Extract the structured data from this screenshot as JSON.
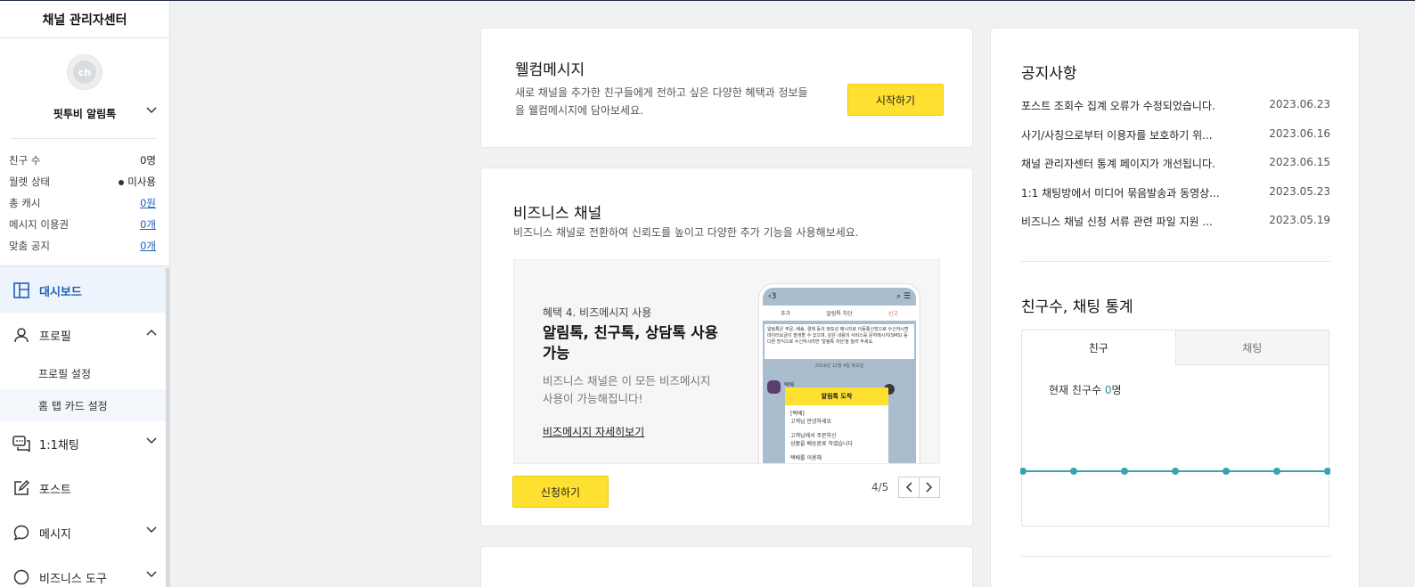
{
  "sidebar": {
    "title": "채널 관리자센터",
    "avatar_text": "ch",
    "channel_name": "핏투비 알림톡",
    "stats": [
      {
        "label": "친구 수",
        "value": "0명",
        "link": false
      },
      {
        "label": "월렛 상태",
        "value": "미사용",
        "link": false,
        "dot": true
      },
      {
        "label": "총 캐시",
        "value": "0원",
        "link": true
      },
      {
        "label": "메시지 이용권",
        "value": "0개",
        "link": true
      },
      {
        "label": "맞춤 공지",
        "value": "0개",
        "link": true
      }
    ],
    "nav": {
      "dashboard": "대시보드",
      "profile": "프로필",
      "profile_settings": "프로필 설정",
      "home_tab_card": "홈 탭 카드 설정",
      "chat": "1:1채팅",
      "post": "포스트",
      "message": "메시지",
      "biz_tools": "비즈니스 도구"
    }
  },
  "welcome": {
    "title": "웰컴메시지",
    "desc": "새로 채널을 추가한 친구들에게 전하고 싶은 다양한 혜택과 정보들을 웰컴메시지에 담아보세요.",
    "button": "시작하기"
  },
  "business": {
    "title": "비즈니스 채널",
    "subtitle": "비즈니스 채널로 전환하여 신뢰도를 높이고 다양한 추가 기능을 사용해보세요.",
    "slide": {
      "small": "혜택 4. 비즈메시지 사용",
      "big": "알림톡, 친구톡, 상담톡 사용 가능",
      "desc": "비즈니스 채널은 이 모든 비즈메시지 사용이 가능해집니다!",
      "more": "비즈메시지 자세히보기"
    },
    "phone": {
      "back": "3",
      "bar_add": "추가",
      "bar_block": "알림톡 차단",
      "bar_report": "신고",
      "notice": "알림톡은 주문, 배송, 결제 등의 정보성 메시지로 이동통신망으로 수신하시면 데이터요금이 발생할 수 있으며, 같은 내용의 서비스를 문자메시지(SMS) 등 다른 방식으로 수신하시려면 '알림톡 차단'을 눌러 주세요.",
      "date": "2019년 12월 4일 화요일",
      "sender": "택배",
      "msg_head": "알림톡 도착",
      "msg_body": [
        "[택배]",
        "고객님 안녕하세요",
        "",
        "고객님께서 주문하신",
        "상품을 배송완료 하였습니다",
        "",
        "택배를 이용해"
      ]
    },
    "button": "신청하기",
    "pager": "4/5"
  },
  "notices": {
    "title": "공지사항",
    "items": [
      {
        "text": "포스트 조회수 집계 오류가 수정되었습니다.",
        "date": "2023.06.23"
      },
      {
        "text": "사기/사칭으로부터 이용자를 보호하기 위...",
        "date": "2023.06.16"
      },
      {
        "text": "채널 관리자센터 통계 페이지가 개선됩니다.",
        "date": "2023.06.15"
      },
      {
        "text": "1:1 채팅방에서 미디어 묶음발송과 동영상...",
        "date": "2023.05.23"
      },
      {
        "text": "비즈니스 채널 신청 서류 관련 파일 지원 ...",
        "date": "2023.05.19"
      }
    ]
  },
  "stats_card": {
    "title": "친구수, 채팅 통계",
    "tab_friends": "친구",
    "tab_chat": "채팅",
    "current_label": "현재 친구수 ",
    "current_value": "0",
    "current_unit": "명",
    "accent": "#3aa3b1"
  },
  "chart_data": {
    "type": "line",
    "series": [
      {
        "values": [
          0,
          0,
          0,
          0,
          0,
          0,
          0
        ]
      }
    ]
  }
}
